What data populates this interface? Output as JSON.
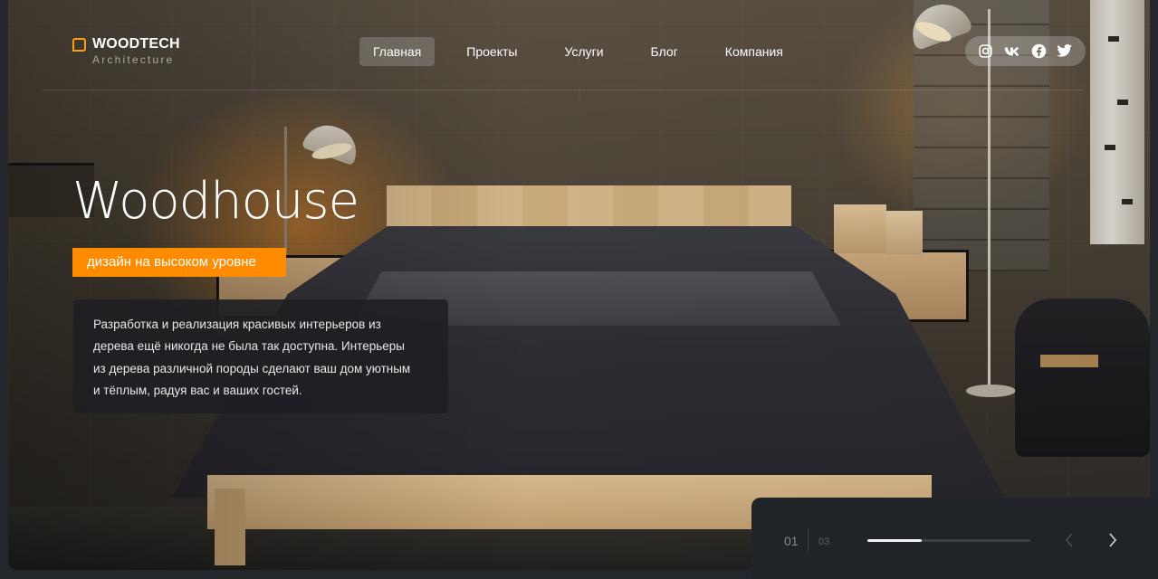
{
  "brand": {
    "name": "WOODTECH",
    "tagline": "Architecture",
    "accent_color": "#ff8c00"
  },
  "nav": {
    "items": [
      {
        "label": "Главная",
        "active": true
      },
      {
        "label": "Проекты",
        "active": false
      },
      {
        "label": "Услуги",
        "active": false
      },
      {
        "label": "Блог",
        "active": false
      },
      {
        "label": "Компания",
        "active": false
      }
    ]
  },
  "social": {
    "icons": [
      "instagram-icon",
      "vk-icon",
      "facebook-icon",
      "twitter-icon"
    ]
  },
  "hero": {
    "title": "Woodhouse",
    "badge": "дизайн на высоком уровне",
    "description_lines": [
      "Разработка и реализация красивых интерьеров из",
      "дерева ещё никогда не была так доступна. Интерьеры",
      "из дерева различной породы сделают ваш дом уютным",
      "и тёплым, радуя вас и ваших гостей."
    ]
  },
  "slider": {
    "current": "01",
    "total": "03",
    "progress": 0.333,
    "prev_icon": "chevron-left-icon",
    "next_icon": "chevron-right-icon"
  }
}
